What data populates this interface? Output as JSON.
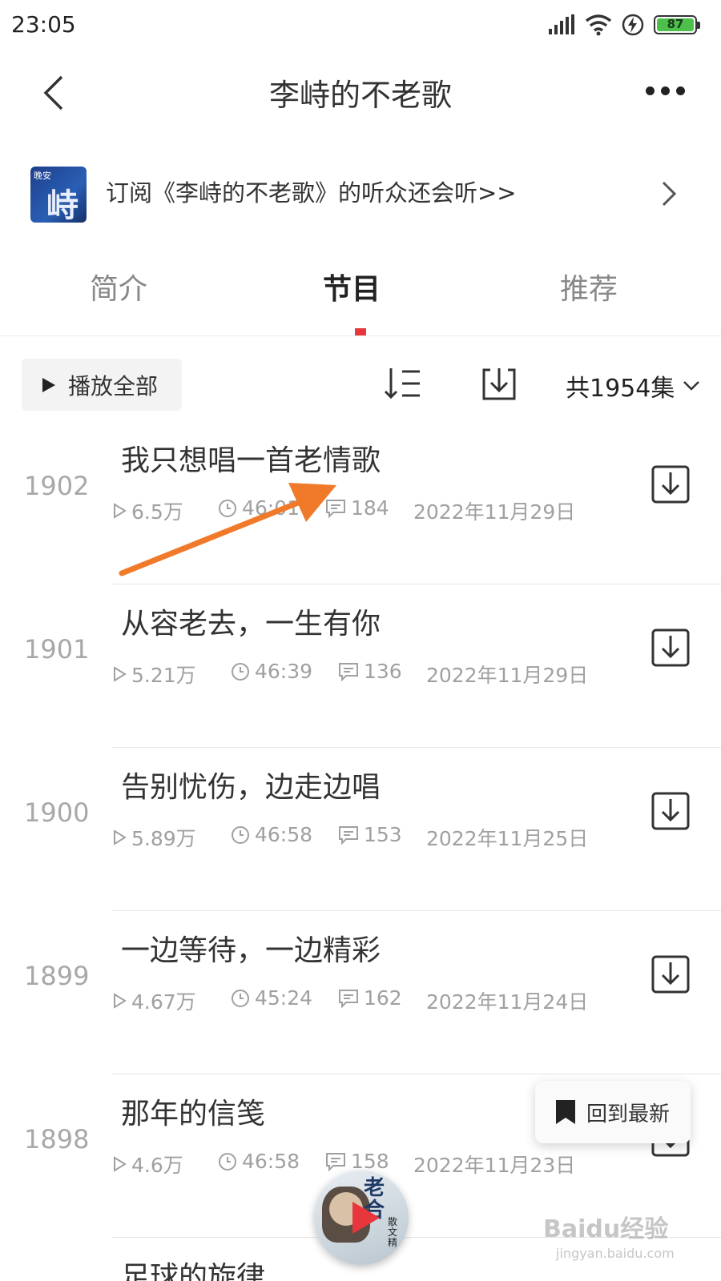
{
  "status_bar": {
    "time": "23:05",
    "battery": "87"
  },
  "header": {
    "title": "李峙的不老歌"
  },
  "banner": {
    "cover_text_small": "晚安",
    "cover_text_big": "峙",
    "text": "订阅《李峙的不老歌》的听众还会听>>"
  },
  "tabs": [
    {
      "label": "简介"
    },
    {
      "label": "节目"
    },
    {
      "label": "推荐"
    }
  ],
  "toolbar": {
    "play_all_label": "播放全部",
    "episode_count": "共1954集"
  },
  "episodes": [
    {
      "num": "1902",
      "title": "我只想唱一首老情歌",
      "plays": "6.5万",
      "duration": "46:01",
      "comments": "184",
      "date": "2022年11月29日"
    },
    {
      "num": "1901",
      "title": "从容老去，一生有你",
      "plays": "5.21万",
      "duration": "46:39",
      "comments": "136",
      "date": "2022年11月29日"
    },
    {
      "num": "1900",
      "title": "告别忧伤，边走边唱",
      "plays": "5.89万",
      "duration": "46:58",
      "comments": "153",
      "date": "2022年11月25日"
    },
    {
      "num": "1899",
      "title": "一边等待，一边精彩",
      "plays": "4.67万",
      "duration": "45:24",
      "comments": "162",
      "date": "2022年11月24日"
    },
    {
      "num": "1898",
      "title": "那年的信笺",
      "plays": "4.6万",
      "duration": "46:58",
      "comments": "158",
      "date": "2022年11月23日"
    },
    {
      "num": "",
      "title": "足球的旋律",
      "plays": "",
      "duration": "",
      "comments": "",
      "date": ""
    }
  ],
  "floating": {
    "back_latest_label": "回到最新"
  },
  "mini_player": {
    "cover_text_1": "老",
    "cover_text_2": "合",
    "cover_text_side": "散文精"
  },
  "watermark": {
    "main": "Baidu经验",
    "sub": "jingyan.baidu.com"
  },
  "colors": {
    "accent": "#e8363d",
    "annotation_arrow": "#f07a2a"
  }
}
